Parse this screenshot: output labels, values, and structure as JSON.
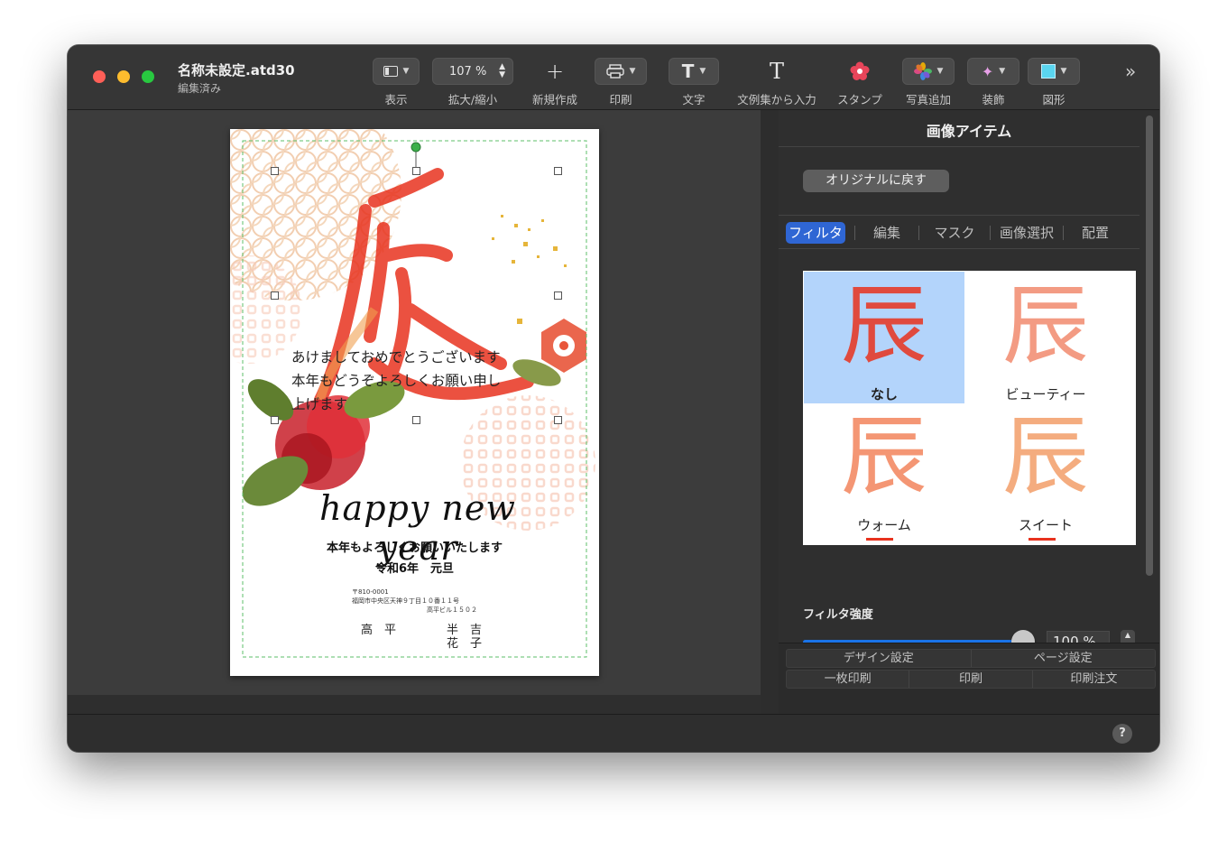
{
  "window": {
    "title": "名称未設定.atd30",
    "subtitle": "編集済み"
  },
  "toolbar": {
    "view": "表示",
    "zoom_value": "107 %",
    "zoom": "拡大/縮小",
    "new": "新規作成",
    "print": "印刷",
    "text": "文字",
    "text_from_examples": "文例集から入力",
    "stamp": "スタンプ",
    "add_photo": "写真追加",
    "decoration": "装飾",
    "shape": "図形"
  },
  "card": {
    "greeting_line1": "あけましておめでとうございます",
    "greeting_line2": "本年もどうぞよろしくお願い申し",
    "greeting_line3": "上げます",
    "script": "happy new year",
    "message": "本年もよろしくお願いいたします",
    "date": "令和6年　元旦",
    "zip": "〒810-0001",
    "address1": "福岡市中央区天神９丁目１０番１１号",
    "address2": "高平ビル１５０２",
    "surname": "高　平",
    "name1": "半　吉",
    "name2": "花　子",
    "kanji": "辰"
  },
  "panel": {
    "title": "画像アイテム",
    "revert_button": "オリジナルに戻す",
    "tabs": [
      "フィルタ",
      "編集",
      "マスク",
      "画像選択",
      "配置"
    ],
    "filters": [
      "なし",
      "ビューティー",
      "ウォーム",
      "スイート"
    ],
    "strength_label": "フィルタ強度",
    "strength_value": "100 %",
    "strength_fraction": 1.0,
    "bottom_row1": [
      "デザイン設定",
      "ページ設定"
    ],
    "bottom_row2": [
      "一枚印刷",
      "印刷",
      "印刷注文"
    ]
  },
  "colors": {
    "accent": "#2f66d4",
    "slider": "#1a73e8",
    "kanji_red": "#e8321e"
  }
}
